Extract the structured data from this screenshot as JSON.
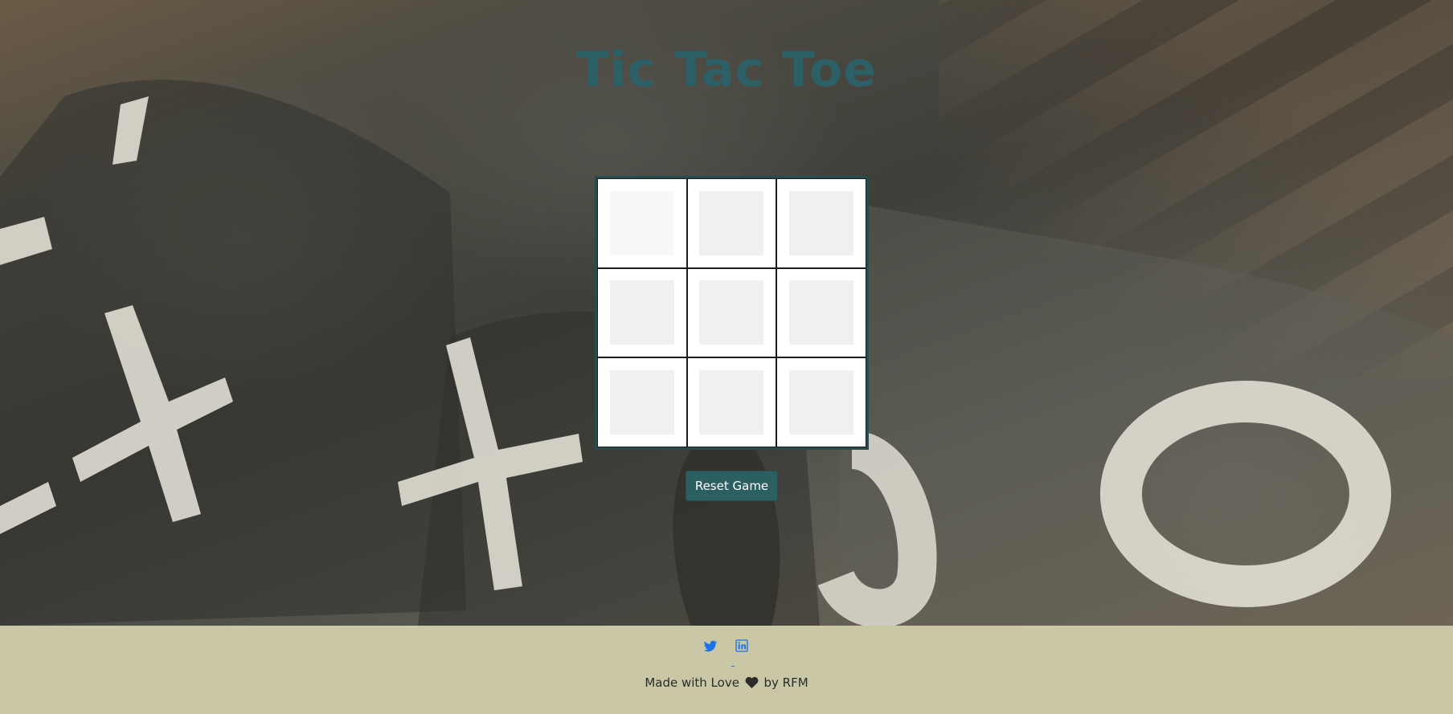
{
  "header": {
    "title": "Tic Tac Toe"
  },
  "board": {
    "cells": [
      "",
      "",
      "",
      "",
      "",
      "",
      "",
      "",
      ""
    ]
  },
  "controls": {
    "reset_label": "Reset Game"
  },
  "footer": {
    "social": [
      {
        "name": "twitter",
        "icon": "twitter-icon"
      },
      {
        "name": "linkedin",
        "icon": "linkedin-icon"
      }
    ],
    "credit_prefix": "Made with Love",
    "credit_suffix": "by RFM"
  },
  "colors": {
    "title": "#2c5f66",
    "button_bg": "#2b5f62",
    "footer_bg": "#c9c7a6",
    "link": "#1a73e8"
  }
}
